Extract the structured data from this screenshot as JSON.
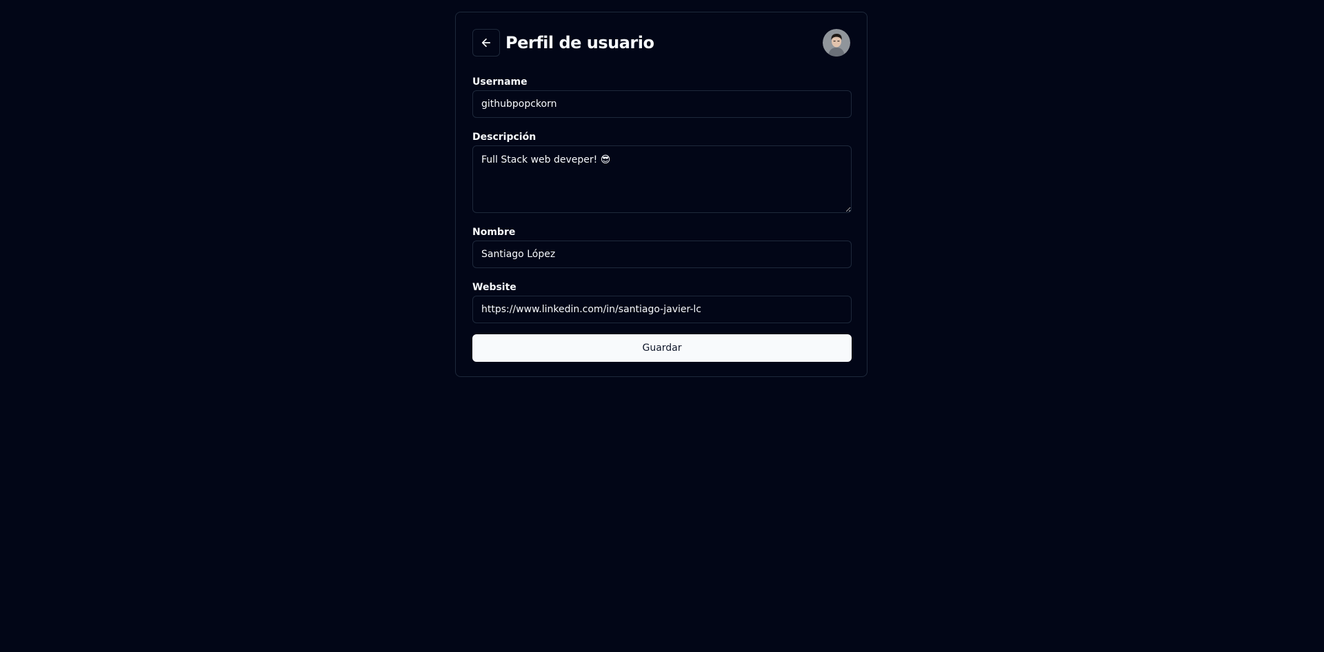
{
  "header": {
    "title": "Perfil de usuario",
    "back_icon": "arrow-left-icon",
    "avatar_icon": "user-avatar"
  },
  "form": {
    "username": {
      "label": "Username",
      "value": "githubpopckorn"
    },
    "description": {
      "label": "Descripción",
      "value": "Full Stack web deveper! 😎"
    },
    "name": {
      "label": "Nombre",
      "value": "Santiago López"
    },
    "website": {
      "label": "Website",
      "value": "https://www.linkedin.com/in/santiago-javier-lc"
    },
    "save_label": "Guardar"
  },
  "colors": {
    "background": "#020617",
    "border": "#1e293b",
    "text": "#f8fafc",
    "button_bg": "#f8fafc",
    "button_text": "#0f172a"
  }
}
